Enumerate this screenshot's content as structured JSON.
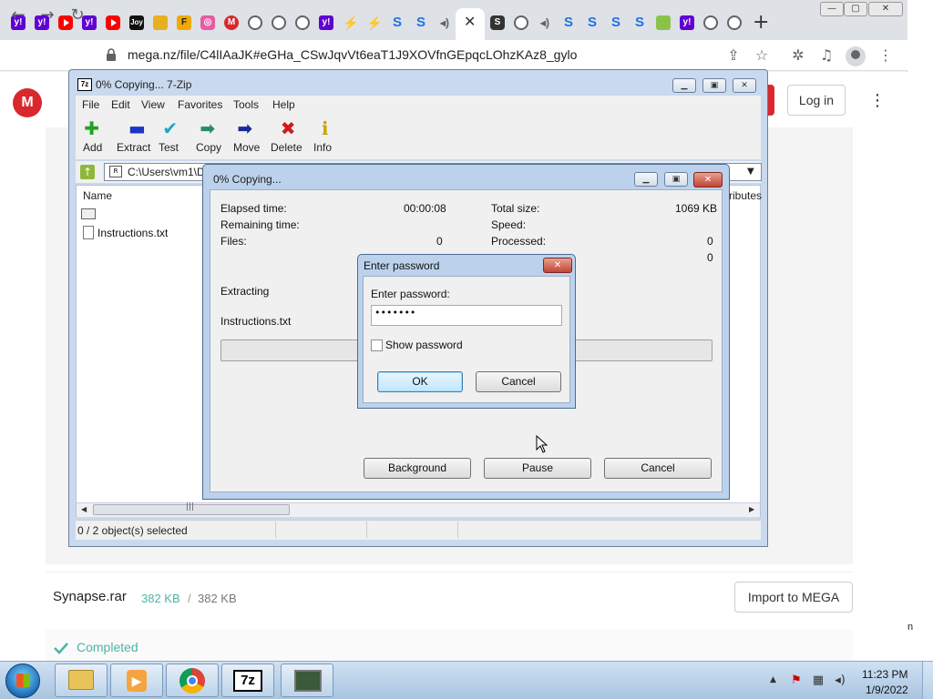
{
  "browser": {
    "tab_icons": [
      {
        "kind": "ti-yahoo",
        "name": "yahoo-icon",
        "glyph": "y!"
      },
      {
        "kind": "ti-yahoo",
        "name": "yahoo-icon",
        "glyph": "y!"
      },
      {
        "kind": "ti-yt",
        "name": "youtube-icon",
        "glyph": ""
      },
      {
        "kind": "ti-yahoo",
        "name": "yahoo-icon",
        "glyph": "y!"
      },
      {
        "kind": "ti-yt",
        "name": "youtube-icon",
        "glyph": ""
      },
      {
        "kind": "ti-joy",
        "name": "joy-icon",
        "glyph": "Joy"
      },
      {
        "kind": "ti-folder",
        "name": "folder-icon",
        "glyph": ""
      },
      {
        "kind": "ti-f",
        "name": "f-icon",
        "glyph": "F"
      },
      {
        "kind": "ti-img",
        "name": "image-icon",
        "glyph": "◎"
      },
      {
        "kind": "ti-mega",
        "name": "mega-tab-icon",
        "glyph": "M"
      },
      {
        "kind": "ti-globe",
        "name": "globe-icon",
        "glyph": ""
      },
      {
        "kind": "ti-globe",
        "name": "globe-icon",
        "glyph": ""
      },
      {
        "kind": "ti-globe",
        "name": "globe-icon",
        "glyph": ""
      },
      {
        "kind": "ti-yahoo",
        "name": "yahoo-icon",
        "glyph": "y!"
      },
      {
        "kind": "ti-bolt",
        "name": "bolt-icon",
        "glyph": "⚡"
      },
      {
        "kind": "ti-bolt",
        "name": "bolt-icon",
        "glyph": "⚡"
      },
      {
        "kind": "ti-s",
        "name": "s-icon",
        "glyph": "S"
      },
      {
        "kind": "ti-s",
        "name": "s-icon",
        "glyph": "S"
      },
      {
        "kind": "ti-spk",
        "name": "speaker-icon",
        "glyph": "◂)"
      },
      {
        "kind": "ti-scr",
        "name": "scribd-icon",
        "glyph": "S"
      },
      {
        "kind": "ti-globe",
        "name": "globe-icon",
        "glyph": ""
      },
      {
        "kind": "ti-spk",
        "name": "speaker-icon",
        "glyph": "◂)"
      },
      {
        "kind": "ti-s",
        "name": "s-icon",
        "glyph": "S"
      },
      {
        "kind": "ti-s",
        "name": "s-icon",
        "glyph": "S"
      },
      {
        "kind": "ti-s",
        "name": "s-icon",
        "glyph": "S"
      },
      {
        "kind": "ti-s",
        "name": "s-icon",
        "glyph": "S"
      },
      {
        "kind": "ti-green",
        "name": "green-icon",
        "glyph": ""
      },
      {
        "kind": "ti-yahoo",
        "name": "yahoo-icon",
        "glyph": "y!"
      },
      {
        "kind": "ti-globe",
        "name": "globe-icon",
        "glyph": ""
      },
      {
        "kind": "ti-globe",
        "name": "globe-icon",
        "glyph": ""
      }
    ],
    "url": "mega.nz/file/C4lIAaJK#eGHa_CSwJqvVt6eaT1J9XOVfnGEpqcLOhzKAz8_gylo",
    "new_tab": "+",
    "close_tab": "✕"
  },
  "mega": {
    "logo": "M",
    "login": "Log in",
    "file_name": "Synapse.rar",
    "size_done": "382 KB",
    "size_sep": "/",
    "size_total": "382 KB",
    "import_label": "Import to MEGA",
    "completed": "Completed",
    "right_edge_char": "n"
  },
  "sevenzip": {
    "title": "0% Copying... 7-Zip",
    "title_icon": "7z",
    "menu": [
      "File",
      "Edit",
      "View",
      "Favorites",
      "Tools",
      "Help"
    ],
    "tools": [
      {
        "label": "Add",
        "glyph": "✚",
        "color": "#1fa31f"
      },
      {
        "label": "Extract",
        "glyph": "▬",
        "color": "#1c34c8"
      },
      {
        "label": "Test",
        "glyph": "✔",
        "color": "#1aa7c6"
      },
      {
        "label": "Copy",
        "glyph": "➡",
        "color": "#2a8a6a"
      },
      {
        "label": "Move",
        "glyph": "➡",
        "color": "#1a2a9a"
      },
      {
        "label": "Delete",
        "glyph": "✖",
        "color": "#d01b1b"
      },
      {
        "label": "Info",
        "glyph": "ℹ",
        "color": "#c9a400"
      }
    ],
    "path": "C:\\Users\\vm1\\D",
    "col_name": "Name",
    "col_attributes": "ributes",
    "files": [
      "",
      "Instructions.txt"
    ],
    "status": "0 / 2 object(s) selected"
  },
  "progress": {
    "title": "0% Copying...",
    "elapsed_label": "Elapsed time:",
    "elapsed_value": "00:00:08",
    "remaining_label": "Remaining time:",
    "files_label": "Files:",
    "files_value": "0",
    "total_label": "Total size:",
    "total_value": "1069 KB",
    "speed_label": "Speed:",
    "processed_label": "Processed:",
    "processed_value": "0",
    "extra_value": "0",
    "action": "Extracting",
    "current_file": "Instructions.txt",
    "progress": 0,
    "buttons": [
      "Background",
      "Pause",
      "Cancel"
    ]
  },
  "password": {
    "title": "Enter password",
    "label": "Enter password:",
    "value": "•••••••",
    "show_label": "Show password",
    "show_checked": false,
    "ok": "OK",
    "cancel": "Cancel"
  },
  "taskbar": {
    "apps": [
      "explorer-icon",
      "media-player-icon",
      "chrome-icon",
      "7zip-icon",
      "terminal-icon"
    ],
    "time": "11:23 PM",
    "date": "1/9/2022"
  }
}
